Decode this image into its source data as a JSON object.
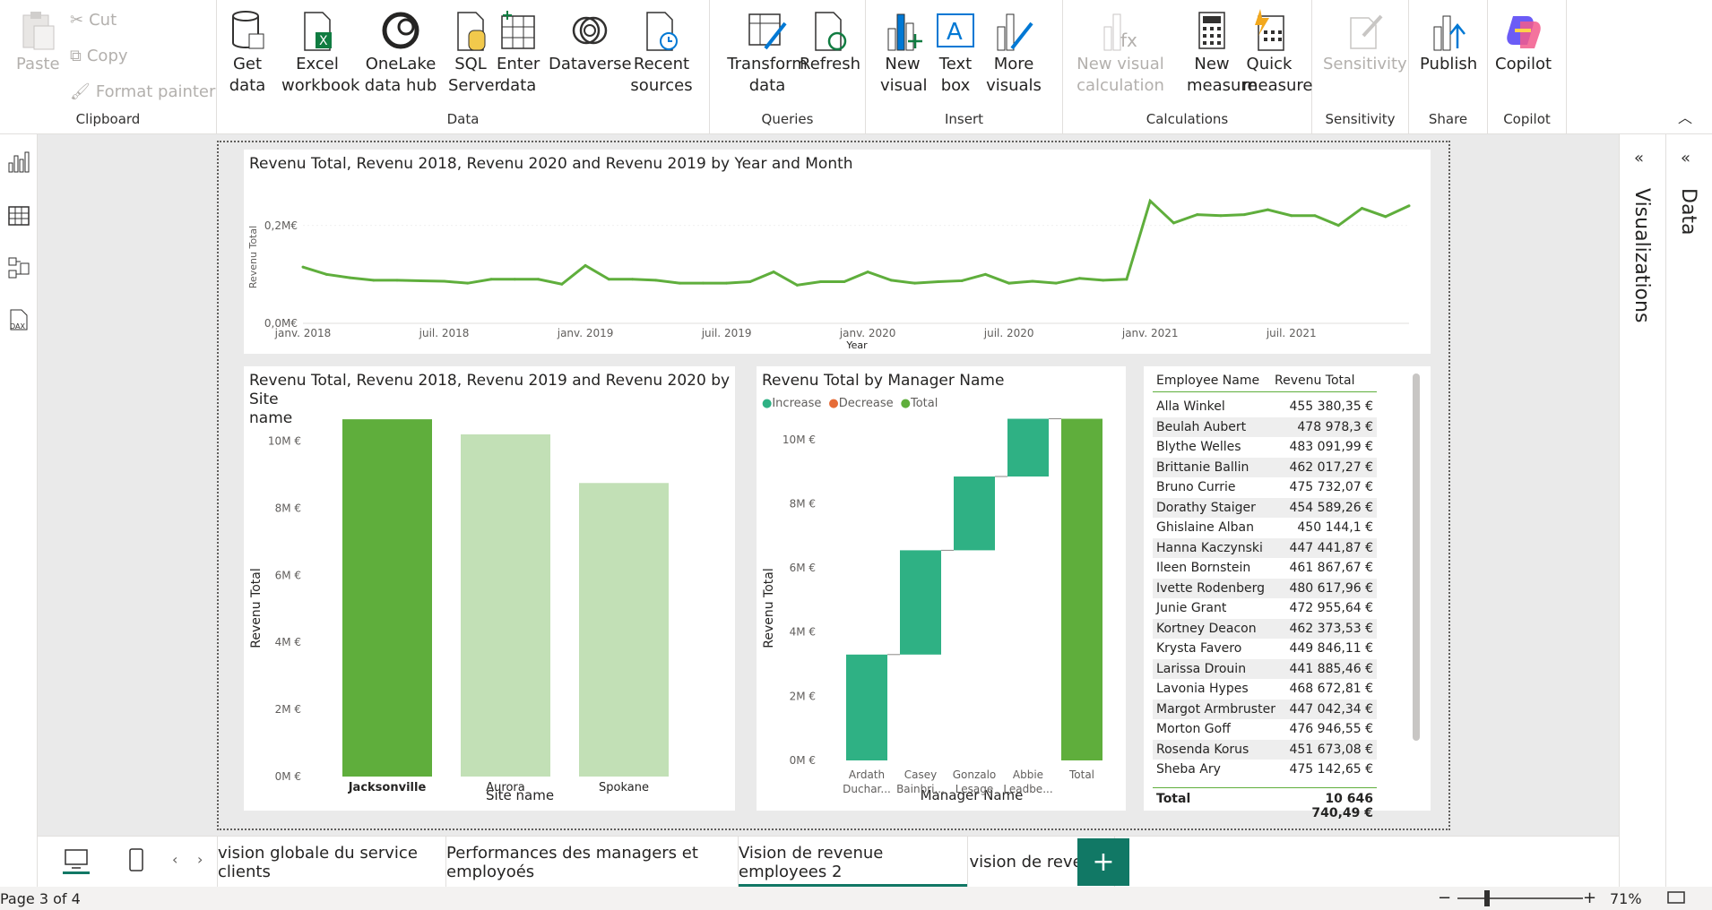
{
  "ribbon": {
    "clipboard": {
      "paste": "Paste",
      "cut": "Cut",
      "copy": "Copy",
      "format_painter": "Format painter",
      "label": "Clipboard"
    },
    "data": {
      "get_data": "Get data",
      "excel": "Excel workbook",
      "onelake": "OneLake data hub",
      "sql": "SQL Server",
      "enter": "Enter data",
      "dataverse": "Dataverse",
      "recent": "Recent sources",
      "label": "Data"
    },
    "queries": {
      "transform": "Transform data",
      "refresh": "Refresh",
      "label": "Queries"
    },
    "insert": {
      "new_visual": "New visual",
      "text_box": "Text box",
      "more_visuals": "More visuals",
      "label": "Insert"
    },
    "calculations": {
      "new_visual_calc": "New visual calculation",
      "new_measure": "New measure",
      "quick_measure": "Quick measure",
      "label": "Calculations"
    },
    "sensitivity": {
      "btn": "Sensitivity",
      "label": "Sensitivity"
    },
    "share": {
      "publish": "Publish",
      "label": "Share"
    },
    "copilot": {
      "btn": "Copilot",
      "label": "Copilot"
    }
  },
  "line_visual": {
    "title": "Revenu Total, Revenu 2018, Revenu 2020 and Revenu 2019 by Year and Month",
    "ylabel": "Revenu Total",
    "xlabel": "Year",
    "yticks": [
      "0,0M€",
      "0,2M€"
    ],
    "xticks": [
      "janv. 2018",
      "juil. 2018",
      "janv. 2019",
      "juil. 2019",
      "janv. 2020",
      "juil. 2020",
      "janv. 2021",
      "juil. 2021"
    ]
  },
  "bar_visual": {
    "title_line1": "Revenu Total, Revenu 2018, Revenu 2019 and Revenu 2020 by Site",
    "title_line2": "name",
    "ylabel": "Revenu Total",
    "xlabel": "Site name",
    "yticks": [
      "0M €",
      "2M €",
      "4M €",
      "6M €",
      "8M €",
      "10M €"
    ]
  },
  "waterfall_visual": {
    "title": "Revenu Total by Manager Name",
    "legend": [
      "Increase",
      "Decrease",
      "Total"
    ],
    "ylabel": "Revenu Total",
    "xlabel": "Manager Name",
    "yticks": [
      "0M €",
      "2M €",
      "4M €",
      "6M €",
      "8M €",
      "10M €"
    ],
    "categories": [
      [
        "Ardath",
        "Duchar..."
      ],
      [
        "Casey",
        "Bainbri..."
      ],
      [
        "Gonzalo",
        "Lesage"
      ],
      [
        "Abbie",
        "Leadbe..."
      ],
      [
        "Total",
        ""
      ]
    ]
  },
  "table_visual": {
    "col1": "Employee Name",
    "col2": "Revenu Total",
    "rows": [
      [
        "Alla Winkel",
        "455 380,35 €"
      ],
      [
        "Beulah Aubert",
        "478 978,3 €"
      ],
      [
        "Blythe Welles",
        "483 091,99 €"
      ],
      [
        "Brittanie Ballin",
        "462 017,27 €"
      ],
      [
        "Bruno Currie",
        "475 732,07 €"
      ],
      [
        "Dorathy Staiger",
        "454 589,26 €"
      ],
      [
        "Ghislaine Alban",
        "450 144,1 €"
      ],
      [
        "Hanna Kaczynski",
        "447 441,87 €"
      ],
      [
        "Ileen Bornstein",
        "461 867,67 €"
      ],
      [
        "Ivette Rodenberg",
        "480 617,96 €"
      ],
      [
        "Junie Grant",
        "472 955,64 €"
      ],
      [
        "Kortney Deacon",
        "462 373,53 €"
      ],
      [
        "Krysta Favero",
        "449 846,11 €"
      ],
      [
        "Larissa Drouin",
        "441 885,46 €"
      ],
      [
        "Lavonia Hypes",
        "468 672,81 €"
      ],
      [
        "Margot Armbruster",
        "447 042,34 €"
      ],
      [
        "Morton Goff",
        "476 946,55 €"
      ],
      [
        "Rosenda Korus",
        "451 673,08 €"
      ],
      [
        "Sheba Ary",
        "475 142,65 €"
      ]
    ],
    "total_label": "Total",
    "total_value": "10 646 740,49 €"
  },
  "panes": {
    "visualizations": "Visualizations",
    "data": "Data"
  },
  "tabs": [
    "vision globale du service clients",
    "Performances des managers et employoés",
    "Vision de revenue employees 2",
    "vision de revenue"
  ],
  "status": {
    "page": "Page 3 of 4",
    "zoom": "71%"
  },
  "colors": {
    "accent": "#117865",
    "line": "#5fae3c",
    "bar_main": "#5fae3c",
    "bar_light": "#c2e0b6",
    "waterfall": "#2fb184",
    "decrease": "#e66c37"
  },
  "chart_data": [
    {
      "type": "line",
      "title": "Revenu Total, Revenu 2018, Revenu 2020 and Revenu 2019 by Year and Month",
      "xlabel": "Year",
      "ylabel": "Revenu Total",
      "ylim": [
        0,
        0.3
      ],
      "x": [
        "2018-01",
        "2018-02",
        "2018-03",
        "2018-04",
        "2018-05",
        "2018-06",
        "2018-07",
        "2018-08",
        "2018-09",
        "2018-10",
        "2018-11",
        "2018-12",
        "2019-01",
        "2019-02",
        "2019-03",
        "2019-04",
        "2019-05",
        "2019-06",
        "2019-07",
        "2019-08",
        "2019-09",
        "2019-10",
        "2019-11",
        "2019-12",
        "2020-01",
        "2020-02",
        "2020-03",
        "2020-04",
        "2020-05",
        "2020-06",
        "2020-07",
        "2020-08",
        "2020-09",
        "2020-10",
        "2020-11",
        "2020-12",
        "2021-01",
        "2021-02",
        "2021-03",
        "2021-04",
        "2021-05",
        "2021-06",
        "2021-07",
        "2021-08",
        "2021-09",
        "2021-10",
        "2021-11",
        "2021-12"
      ],
      "series": [
        {
          "values": [
            0.115,
            0.1,
            0.093,
            0.088,
            0.088,
            0.087,
            0.086,
            0.082,
            0.09,
            0.09,
            0.09,
            0.08,
            0.118,
            0.09,
            0.09,
            0.088,
            0.082,
            0.082,
            0.082,
            0.085,
            0.105,
            0.078,
            0.085,
            0.085,
            0.105,
            0.088,
            0.082,
            0.085,
            0.087,
            0.1,
            0.082,
            0.086,
            0.082,
            0.092,
            0.088,
            0.09,
            0.25,
            0.205,
            0.222,
            0.22,
            0.222,
            0.232,
            0.22,
            0.22,
            0.2,
            0.235,
            0.218,
            0.24
          ]
        }
      ]
    },
    {
      "type": "bar",
      "title": "Revenu Total, Revenu 2018, Revenu 2019 and Revenu 2020 by Site name",
      "xlabel": "Site name",
      "ylabel": "Revenu Total",
      "ylim": [
        0,
        11
      ],
      "categories": [
        "Jacksonville",
        "Aurora",
        "Spokane"
      ],
      "values": [
        10.65,
        10.2,
        8.75
      ]
    },
    {
      "type": "bar",
      "title": "Revenu Total by Manager Name",
      "xlabel": "Manager Name",
      "ylabel": "Revenu Total",
      "ylim": [
        0,
        11
      ],
      "categories": [
        "Ardath Duchar...",
        "Casey Bainbri...",
        "Gonzalo Lesage",
        "Abbie Leadbe...",
        "Total"
      ],
      "values": [
        3.3,
        3.25,
        2.3,
        1.8,
        10.65
      ]
    }
  ]
}
